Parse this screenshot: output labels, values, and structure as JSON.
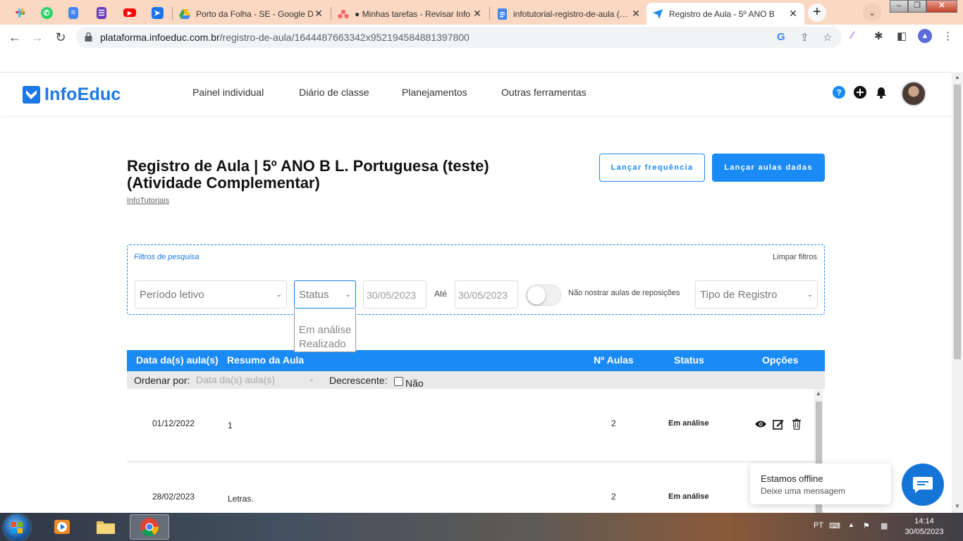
{
  "browser": {
    "tabs": [
      {
        "title": "Porto da Folha - SE - Google D"
      },
      {
        "title": "● Minhas tarefas - Revisar Info"
      },
      {
        "title": "infotutorial-registro-de-aula (…"
      },
      {
        "title": "Registro de Aula - 5º ANO B"
      }
    ],
    "url_host": "plataforma.infoeduc.com.br",
    "url_path": "/registro-de-aula/1644487663342x952194584881397800"
  },
  "site": {
    "logo": "InfoEduc",
    "nav": [
      "Painel individual",
      "Diário de classe",
      "Planejamentos",
      "Outras ferramentas"
    ]
  },
  "page": {
    "title": "Registro de Aula | 5º ANO B L. Portuguesa (teste) (Atividade Complementar)",
    "subtitle": "InfoTutoriais",
    "btn_frequencia": "Lançar frequência",
    "btn_aulas": "Lançar aulas dadas"
  },
  "filters": {
    "label": "Filtros de pesquisa",
    "clear": "Limpar filtros",
    "periodo_placeholder": "Período letivo",
    "status_placeholder": "Status",
    "date_from": "30/05/2023",
    "ate": "Até",
    "date_to": "30/05/2023",
    "toggle_label": "Não nostrar aulas de reposições",
    "tipo_placeholder": "Tipo de Registro",
    "status_options": [
      "Em análise",
      "Realizado"
    ]
  },
  "table": {
    "headers": [
      "Data da(s) aula(s)",
      "Resumo da Aula",
      "Nº Aulas",
      "Status",
      "Opções"
    ],
    "sort_label": "Ordenar por:",
    "sort_value": "Data da(s) aula(s)",
    "desc_label": "Decrescente:",
    "desc_value": "Não",
    "rows": [
      {
        "date": "01/12/2022",
        "summary": "1",
        "count": "2",
        "status": "Em análise"
      },
      {
        "date": "28/02/2023",
        "summary": "Letras.",
        "count": "2",
        "status": "Em análise"
      }
    ]
  },
  "chat": {
    "status": "Estamos offline",
    "message": "Deixe uma mensagem"
  },
  "taskbar": {
    "lang": "PT",
    "time": "14:14",
    "date": "30/05/2023"
  },
  "colors": {
    "brand": "#1a79e6",
    "primary_button": "#1a8af5",
    "tab_strip": "#fbd8c2"
  }
}
